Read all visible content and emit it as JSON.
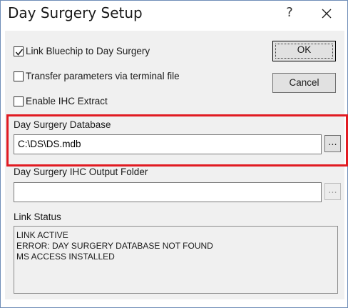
{
  "window": {
    "title": "Day Surgery Setup",
    "help_glyph": "?",
    "close_icon": "close-icon"
  },
  "options": {
    "link_bluechip": {
      "label": "Link Bluechip to Day Surgery",
      "checked": true
    },
    "transfer_params": {
      "label": "Transfer parameters via terminal file",
      "checked": false
    },
    "enable_ihc": {
      "label": "Enable IHC Extract",
      "checked": false
    }
  },
  "buttons": {
    "ok_label": "OK",
    "cancel_label": "Cancel",
    "browse_label": "..."
  },
  "database": {
    "label": "Day Surgery Database",
    "value": "C:\\DS\\DS.mdb"
  },
  "ihc_output": {
    "label": "Day Surgery IHC Output Folder",
    "value": ""
  },
  "link_status": {
    "label": "Link Status",
    "lines": [
      "LINK ACTIVE",
      "ERROR: DAY SURGERY DATABASE NOT FOUND",
      "MS ACCESS INSTALLED"
    ]
  },
  "colors": {
    "highlight": "#e11b22",
    "dialog_bg": "#f0f0f0"
  }
}
